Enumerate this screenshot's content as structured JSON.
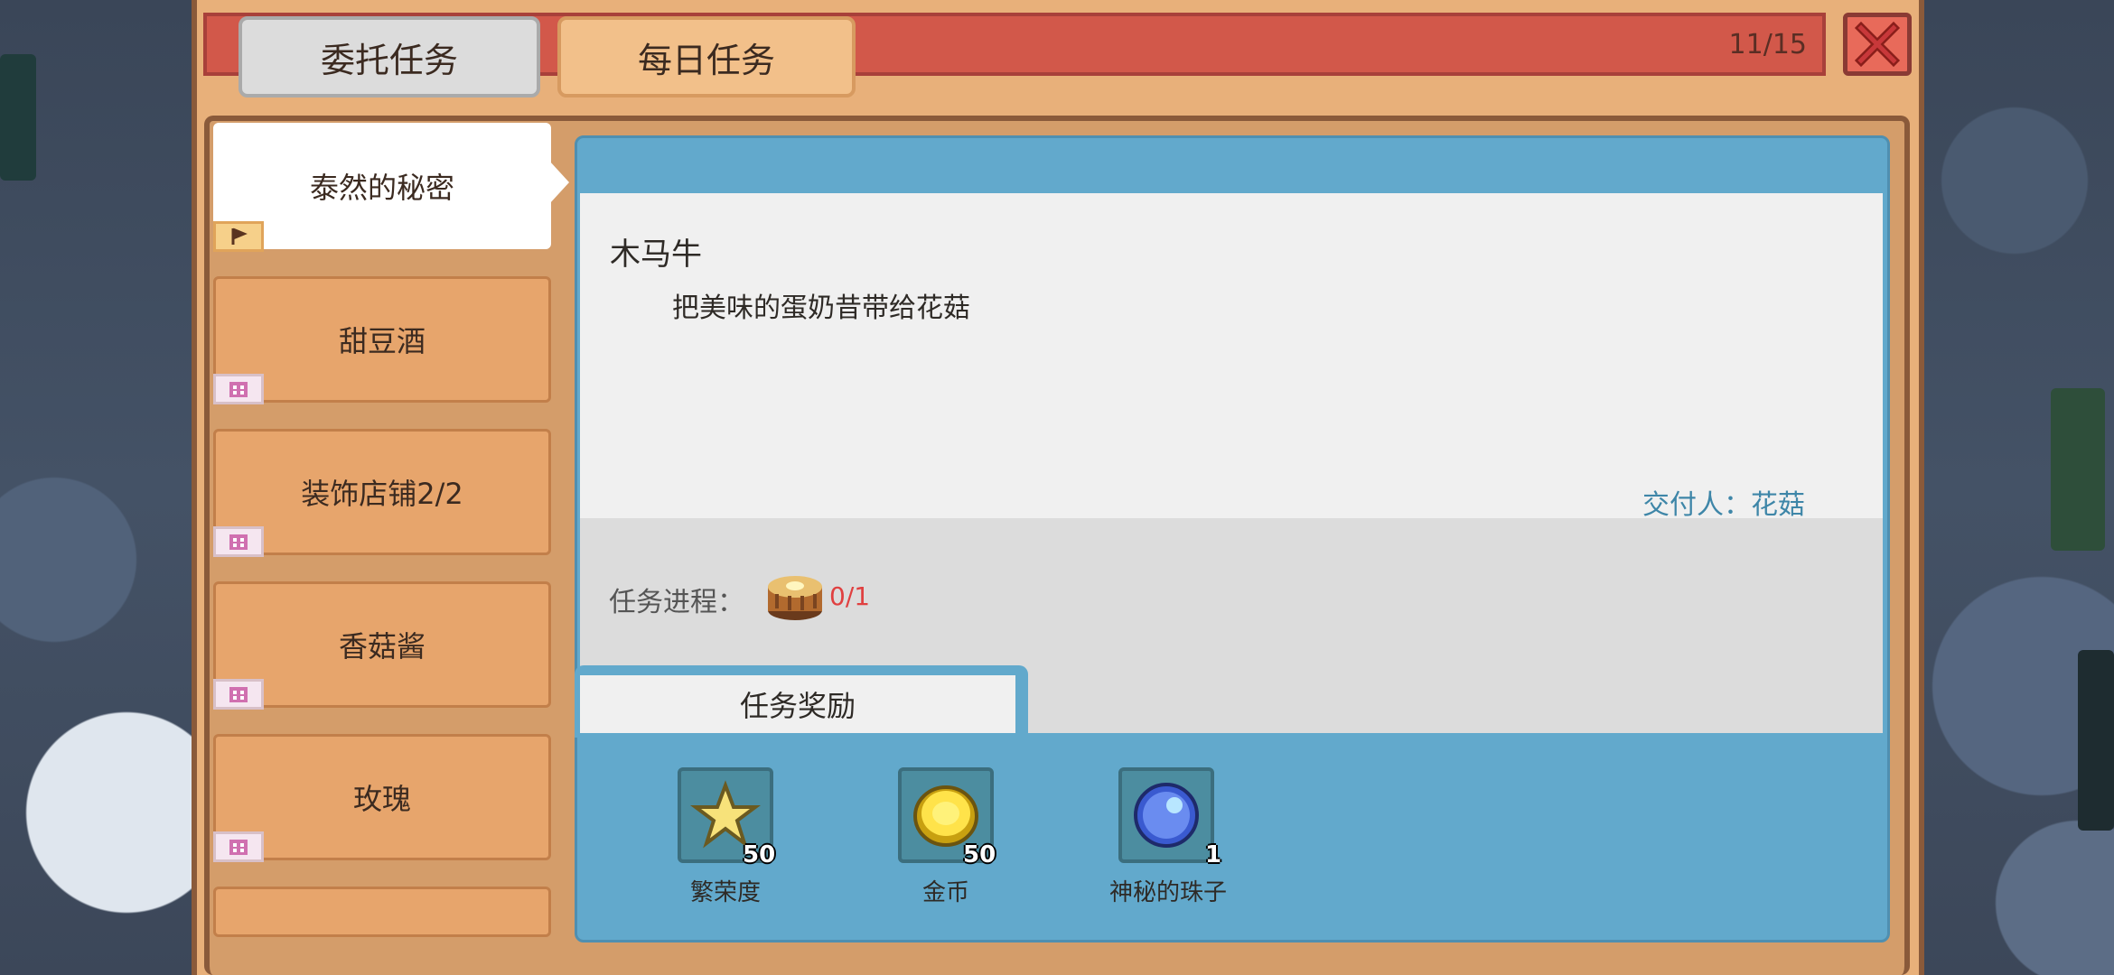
{
  "header": {
    "tabs": [
      {
        "label": "委托任务",
        "active": true
      },
      {
        "label": "每日任务",
        "active": false
      }
    ],
    "counter": "11/15"
  },
  "quest_list": [
    {
      "label": "泰然的秘密",
      "active": true,
      "badge_icon": "flag-icon"
    },
    {
      "label": "甜豆酒",
      "active": false,
      "badge_icon": "building-icon"
    },
    {
      "label": "装饰店铺2/2",
      "active": false,
      "badge_icon": "building-icon"
    },
    {
      "label": "香菇酱",
      "active": false,
      "badge_icon": "building-icon"
    },
    {
      "label": "玫瑰",
      "active": false,
      "badge_icon": "building-icon"
    },
    {
      "label": "",
      "active": false
    }
  ],
  "detail": {
    "title": "木马牛",
    "description": "把美味的蛋奶昔带给花菇",
    "giver": "交付人：花菇",
    "progress_label": "任务进程：",
    "progress_item_icon": "custard-icon",
    "progress_count": "0/1"
  },
  "rewards": {
    "tab_label": "任务奖励",
    "items": [
      {
        "icon": "star-icon",
        "qty": "50",
        "label": "繁荣度"
      },
      {
        "icon": "gold-coin-icon",
        "qty": "50",
        "label": "金币"
      },
      {
        "icon": "blue-orb-icon",
        "qty": "1",
        "label": "神秘的珠子"
      }
    ]
  },
  "colors": {
    "accent_red": "#d2584a",
    "panel_blue": "#62a9cc",
    "frame_orange": "#e8b07a",
    "progress_red": "#e04040"
  }
}
